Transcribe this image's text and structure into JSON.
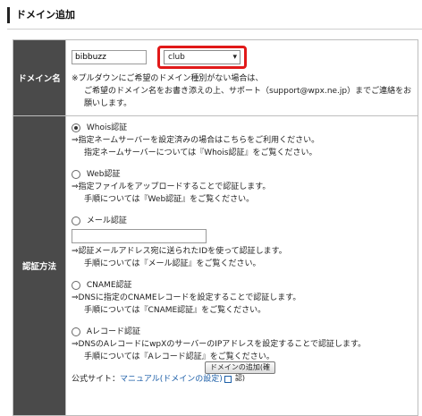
{
  "header": {
    "title": "ドメイン追加"
  },
  "domain_row": {
    "label": "ドメイン名",
    "name_value": "bibbuzz",
    "type_selected": "club",
    "note_line1": "※プルダウンにご希望のドメイン種別がない場合は、",
    "note_line2": "ご希望のドメイン名をお書き添えの上、サポート（support@wpx.ne.jp）までご連絡をお願いします。"
  },
  "auth_row": {
    "label": "認証方法",
    "options": [
      {
        "label": "Whois認証",
        "line1": "⇒指定ネームサーバーを設定済みの場合はこちらをご利用ください。",
        "line2": "指定ネームサーバーについては『Whois認証』をご覧ください。"
      },
      {
        "label": "Web認証",
        "line1": "⇒指定ファイルをアップロードすることで認証します。",
        "line2": "手順については『Web認証』をご覧ください。"
      },
      {
        "label": "メール認証",
        "line1": "⇒認証メールアドレス宛に送られたIDを使って認証します。",
        "line2": "手順については『メール認証』をご覧ください。"
      },
      {
        "label": "CNAME認証",
        "line1": "⇒DNSに指定のCNAMEレコードを設定することで認証します。",
        "line2": "手順については『CNAME認証』をご覧ください。"
      },
      {
        "label": "Aレコード認証",
        "line1": "⇒DNSのAレコードにwpXのサーバーのIPアドレスを設定することで認証します。",
        "line2": "手順については『Aレコード認証』をご覧ください。"
      }
    ],
    "official_prefix": "公式サイト：",
    "official_link": "マニュアル(ドメインの設定)"
  },
  "submit_label": "ドメインの追加(確認)"
}
